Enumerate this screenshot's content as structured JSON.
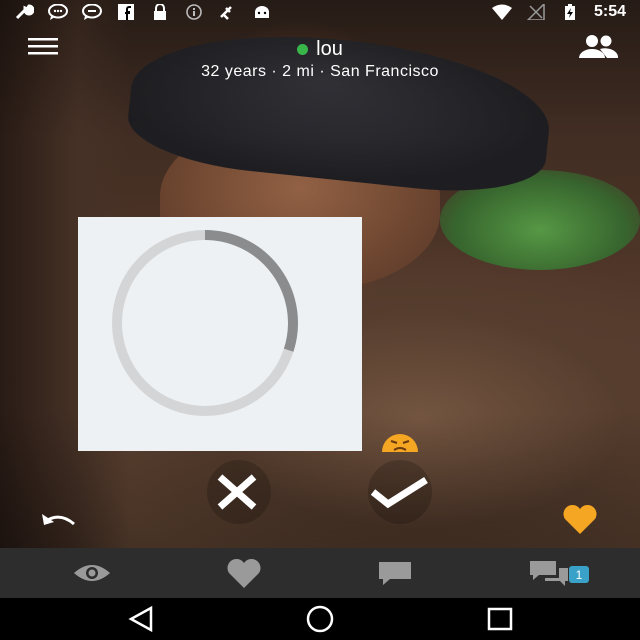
{
  "status_bar": {
    "time": "5:54",
    "left_icons": [
      "wrench-icon",
      "chat-bubble-icon",
      "chat-bubble-icon",
      "facebook-icon",
      "lock-icon",
      "info-icon",
      "satellite-icon",
      "android-icon"
    ],
    "right_icons": [
      "wifi-icon",
      "signal-off-icon",
      "battery-charging-icon"
    ]
  },
  "profile": {
    "name": "lou",
    "online": true,
    "details": "32 years · 2 mi · San Francisco"
  },
  "loading": {
    "progress": 0.3
  },
  "actions": {
    "reject_icon": "close-icon",
    "accept_icon": "checkmark-icon",
    "undo_icon": "undo-icon",
    "favorite_icon": "heart-icon",
    "reaction_icon": "frowning-face-icon"
  },
  "tabs": [
    {
      "icon": "eye-icon"
    },
    {
      "icon": "heart-icon"
    },
    {
      "icon": "message-icon"
    },
    {
      "icon": "conversations-icon",
      "badge": "1"
    }
  ],
  "colors": {
    "online": "#39b54a",
    "favorite": "#f5a623",
    "badge": "#3aa2c8",
    "tab_bar": "#2d2d2d"
  }
}
